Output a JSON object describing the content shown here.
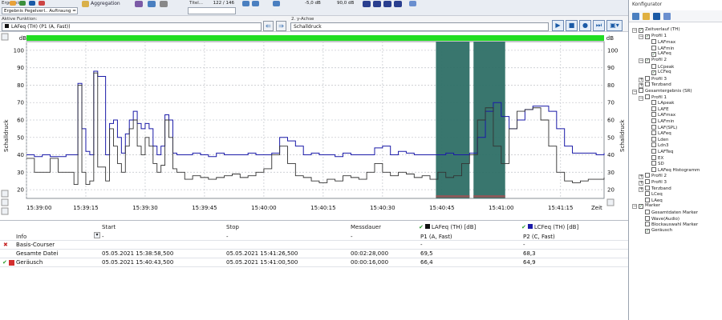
{
  "toolbar": {
    "dropdown_label": "Ergebnis Pegelverl.. Auftraung = 10",
    "aggregation_label": "Aggregation",
    "title_label": "Titel...",
    "counter_value": "122 / 146",
    "offset_value": "-5,0 dB",
    "level_value": "90,0 dB"
  },
  "function_row": {
    "active_function_label": "Aktive Funktion:",
    "active_function_value": "LAFeq (TH) (P1 (A, Fast))",
    "y_axis_label": "2. y-Achse",
    "y_axis_value": "Schalldruck"
  },
  "chart": {
    "unit_left": "dB",
    "unit_right": "dB",
    "ylabel_left": "Schalldruck",
    "ylabel_right": "Schalldruck",
    "x_end_label": "Zeit",
    "line_color_blue": "#1a1aa8",
    "line_color_black": "#333333",
    "highlight_color": "#2e6f66",
    "top_bar_color": "#22dd22"
  },
  "chart_data": {
    "type": "line",
    "ylim": [
      15,
      105
    ],
    "yticks": [
      20,
      30,
      40,
      50,
      60,
      70,
      80,
      90,
      100
    ],
    "xlim": [
      "15:39:00",
      "15:41:26"
    ],
    "xticks": [
      "15:39:00",
      "15:39:15",
      "15:39:30",
      "15:39:45",
      "15:40:00",
      "15:40:15",
      "15:40:30",
      "15:40:45",
      "15:41:00",
      "15:41:15"
    ],
    "highlight_ranges": [
      [
        "15:40:43,5",
        "15:40:52"
      ],
      [
        "15:40:53",
        "15:41:01"
      ]
    ],
    "series": [
      {
        "name": "LCFeq (TH)",
        "x": [
          0,
          2,
          4,
          6,
          8,
          10,
          12,
          13,
          14,
          15,
          16,
          17,
          18,
          20,
          21,
          22,
          23,
          24,
          25,
          26,
          27,
          28,
          29,
          30,
          31,
          32,
          33,
          34,
          35,
          36,
          37,
          38,
          40,
          42,
          44,
          46,
          48,
          50,
          52,
          54,
          56,
          58,
          60,
          62,
          64,
          66,
          68,
          70,
          72,
          74,
          76,
          78,
          80,
          82,
          84,
          86,
          88,
          90,
          92,
          94,
          96,
          98,
          100,
          102,
          104,
          106,
          108,
          110,
          112,
          114,
          116,
          118,
          120,
          122,
          124,
          126,
          128,
          130,
          132,
          134,
          136,
          138,
          140,
          142,
          144,
          146
        ],
        "values": [
          40,
          39,
          40,
          39,
          39,
          40,
          40,
          81,
          55,
          42,
          40,
          88,
          85,
          40,
          58,
          60,
          50,
          41,
          52,
          60,
          65,
          58,
          55,
          58,
          55,
          45,
          40,
          45,
          63,
          60,
          41,
          40,
          40,
          41,
          40,
          39,
          41,
          40,
          40,
          40,
          41,
          40,
          40,
          41,
          50,
          48,
          45,
          40,
          41,
          40,
          40,
          39,
          41,
          40,
          40,
          40,
          44,
          45,
          40,
          42,
          41,
          40,
          40,
          40,
          40,
          41,
          40,
          40,
          41,
          50,
          65,
          70,
          62,
          55,
          60,
          66,
          68,
          68,
          65,
          55,
          45,
          41,
          41,
          41,
          40,
          41
        ]
      },
      {
        "name": "LAFeq (TH)",
        "x": [
          0,
          2,
          4,
          6,
          8,
          10,
          12,
          13,
          14,
          15,
          16,
          17,
          18,
          20,
          21,
          22,
          23,
          24,
          25,
          26,
          27,
          28,
          29,
          30,
          31,
          32,
          33,
          34,
          35,
          36,
          37,
          38,
          40,
          42,
          44,
          46,
          48,
          50,
          52,
          54,
          56,
          58,
          60,
          62,
          64,
          66,
          68,
          70,
          72,
          74,
          76,
          78,
          80,
          82,
          84,
          86,
          88,
          90,
          92,
          94,
          96,
          98,
          100,
          102,
          104,
          106,
          108,
          110,
          112,
          114,
          116,
          118,
          120,
          122,
          124,
          126,
          128,
          130,
          132,
          134,
          136,
          138,
          140,
          142,
          144,
          146
        ],
        "values": [
          38,
          30,
          30,
          38,
          30,
          30,
          23,
          80,
          30,
          23,
          25,
          87,
          33,
          25,
          55,
          45,
          35,
          30,
          45,
          55,
          60,
          45,
          40,
          50,
          45,
          35,
          30,
          34,
          60,
          50,
          32,
          30,
          26,
          28,
          27,
          26,
          27,
          28,
          29,
          27,
          28,
          30,
          32,
          40,
          45,
          35,
          28,
          27,
          25,
          24,
          26,
          25,
          28,
          27,
          26,
          30,
          35,
          30,
          28,
          30,
          29,
          27,
          28,
          26,
          30,
          27,
          28,
          35,
          40,
          60,
          67,
          45,
          35,
          55,
          65,
          66,
          67,
          60,
          45,
          30,
          25,
          24,
          25,
          26,
          26,
          27
        ]
      }
    ]
  },
  "table": {
    "headers": {
      "info": "Info",
      "start": "Start",
      "stop": "Stop",
      "duration": "Messdauer",
      "col1_title": "LAFeq (TH) [dB]",
      "col1_sub": "P1 (A, Fast)",
      "col2_title": "LCFeq (TH) [dB]",
      "col2_sub": "P2 (C, Fast)"
    },
    "rows": [
      {
        "info": "Basis-Courser",
        "start": "-",
        "stop": "-",
        "duration": "-",
        "v1": "-",
        "v2": "-"
      },
      {
        "info": "Gesamte Datei",
        "start": "05.05.2021 15:38:58,500",
        "stop": "05.05.2021 15:41:26,500",
        "duration": "00:02:28,000",
        "v1": "69,5",
        "v2": "68,3"
      },
      {
        "info": "Geräusch",
        "start": "05.05.2021 15:40:43,500",
        "stop": "05.05.2021 15:41:00,500",
        "duration": "00:00:16,000",
        "v1": "66,4",
        "v2": "64,9"
      }
    ]
  },
  "configurator": {
    "title": "Konfigurator",
    "tree": [
      {
        "label": "Zeitverlauf (TH)",
        "level": 0,
        "checked": true,
        "expander": "-"
      },
      {
        "label": "Profil 1",
        "level": 1,
        "checked": true,
        "expander": "-"
      },
      {
        "label": "LAFmax",
        "level": 2,
        "checked": false,
        "expander": ""
      },
      {
        "label": "LAFmin",
        "level": 2,
        "checked": false,
        "expander": ""
      },
      {
        "label": "LAFeq",
        "level": 2,
        "checked": true,
        "expander": ""
      },
      {
        "label": "Profil 2",
        "level": 1,
        "checked": true,
        "expander": "-"
      },
      {
        "label": "LCpeak",
        "level": 2,
        "checked": false,
        "expander": ""
      },
      {
        "label": "LCFeq",
        "level": 2,
        "checked": true,
        "expander": ""
      },
      {
        "label": "Profil 3",
        "level": 1,
        "checked": false,
        "expander": "+"
      },
      {
        "label": "Terzband",
        "level": 1,
        "checked": false,
        "expander": "+"
      },
      {
        "label": "Gesamtergebnis (SR)",
        "level": 0,
        "checked": false,
        "expander": "-"
      },
      {
        "label": "Profil 1",
        "level": 1,
        "checked": false,
        "expander": "-"
      },
      {
        "label": "LApeak",
        "level": 2,
        "checked": false,
        "expander": ""
      },
      {
        "label": "LAFE",
        "level": 2,
        "checked": false,
        "expander": ""
      },
      {
        "label": "LAFmax",
        "level": 2,
        "checked": false,
        "expander": ""
      },
      {
        "label": "LAFmin",
        "level": 2,
        "checked": false,
        "expander": ""
      },
      {
        "label": "LAF(SPL)",
        "level": 2,
        "checked": false,
        "expander": ""
      },
      {
        "label": "LAFeq",
        "level": 2,
        "checked": false,
        "expander": ""
      },
      {
        "label": "Lden",
        "level": 2,
        "checked": false,
        "expander": ""
      },
      {
        "label": "Ldn3",
        "level": 2,
        "checked": false,
        "expander": ""
      },
      {
        "label": "LAFTeq",
        "level": 2,
        "checked": false,
        "expander": ""
      },
      {
        "label": "EX",
        "level": 2,
        "checked": false,
        "expander": ""
      },
      {
        "label": "SD",
        "level": 2,
        "checked": false,
        "expander": ""
      },
      {
        "label": "LAFeq Histogramm",
        "level": 2,
        "checked": false,
        "expander": ""
      },
      {
        "label": "Profil 2",
        "level": 1,
        "checked": false,
        "expander": "+"
      },
      {
        "label": "Profil 3",
        "level": 1,
        "checked": false,
        "expander": "+"
      },
      {
        "label": "Terzband",
        "level": 1,
        "checked": false,
        "expander": "+"
      },
      {
        "label": "LCeq",
        "level": 1,
        "checked": false,
        "expander": ""
      },
      {
        "label": "LAeq",
        "level": 1,
        "checked": false,
        "expander": ""
      },
      {
        "label": "Marker",
        "level": 0,
        "checked": true,
        "expander": "-"
      },
      {
        "label": "Gesamtdaten Marker",
        "level": 1,
        "checked": false,
        "expander": ""
      },
      {
        "label": "Wave(Audio)",
        "level": 1,
        "checked": false,
        "expander": ""
      },
      {
        "label": "Blockauswahl Marker",
        "level": 1,
        "checked": false,
        "expander": ""
      },
      {
        "label": "Geräusch",
        "level": 1,
        "checked": true,
        "expander": ""
      }
    ]
  }
}
